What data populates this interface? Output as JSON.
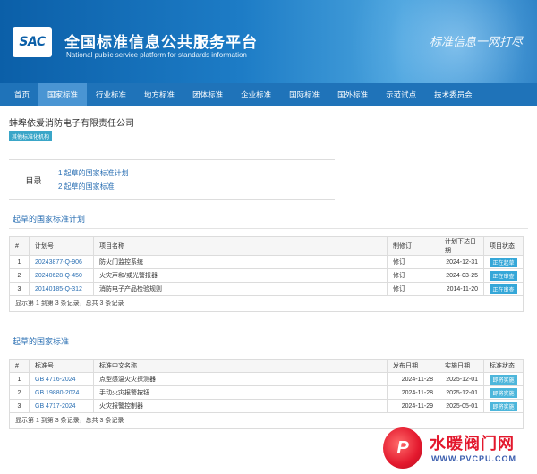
{
  "header": {
    "logo_text": "SAC",
    "title_cn": "全国标准信息公共服务平台",
    "title_en": "National public service platform  for standards information",
    "slogan": "标准信息一网打尽"
  },
  "nav": [
    "首页",
    "国家标准",
    "行业标准",
    "地方标准",
    "团体标准",
    "企业标准",
    "国际标准",
    "国外标准",
    "示范试点",
    "技术委员会"
  ],
  "company": {
    "name": "蚌埠依爱消防电子有限责任公司",
    "badge": "其他标准化机构"
  },
  "toc": {
    "label": "目录",
    "links": [
      "1  起草的国家标准计划",
      "2  起草的国家标准"
    ]
  },
  "plans": {
    "title": "起草的国家标准计划",
    "headers": [
      "#",
      "计划号",
      "项目名称",
      "制修订",
      "计划下达日期",
      "项目状态"
    ],
    "rows": [
      {
        "no": "1",
        "code": "20243877-Q-906",
        "name": "防火门监控系统",
        "type": "修订",
        "date": "2024-12-31",
        "status": "正在起草"
      },
      {
        "no": "2",
        "code": "20240628-Q-450",
        "name": "火灾声和/或光警报器",
        "type": "修订",
        "date": "2024-03-25",
        "status": "正在审查"
      },
      {
        "no": "3",
        "code": "20140185-Q-312",
        "name": "消防电子产品检验规则",
        "type": "修订",
        "date": "2014-11-20",
        "status": "正在审查"
      }
    ],
    "summary": "显示第 1 到第 3 条记录，总共 3 条记录"
  },
  "standards": {
    "title": "起草的国家标准",
    "headers": [
      "#",
      "标准号",
      "标准中文名称",
      "发布日期",
      "实施日期",
      "标准状态"
    ],
    "rows": [
      {
        "no": "1",
        "code": "GB 4716-2024",
        "name": "点型感温火灾探测器",
        "pub": "2024-11-28",
        "impl": "2025-12-01",
        "status": "即将实施"
      },
      {
        "no": "2",
        "code": "GB 19880-2024",
        "name": "手动火灾报警按钮",
        "pub": "2024-11-28",
        "impl": "2025-12-01",
        "status": "即将实施"
      },
      {
        "no": "3",
        "code": "GB 4717-2024",
        "name": "火灾报警控制器",
        "pub": "2024-11-29",
        "impl": "2025-05-01",
        "status": "即将实施"
      }
    ],
    "summary": "显示第 1 到第 3 条记录，总共 3 条记录"
  },
  "watermark": {
    "logo_letter": "P",
    "text": "水暖阀门网",
    "url": "WWW.PVCPU.COM"
  }
}
